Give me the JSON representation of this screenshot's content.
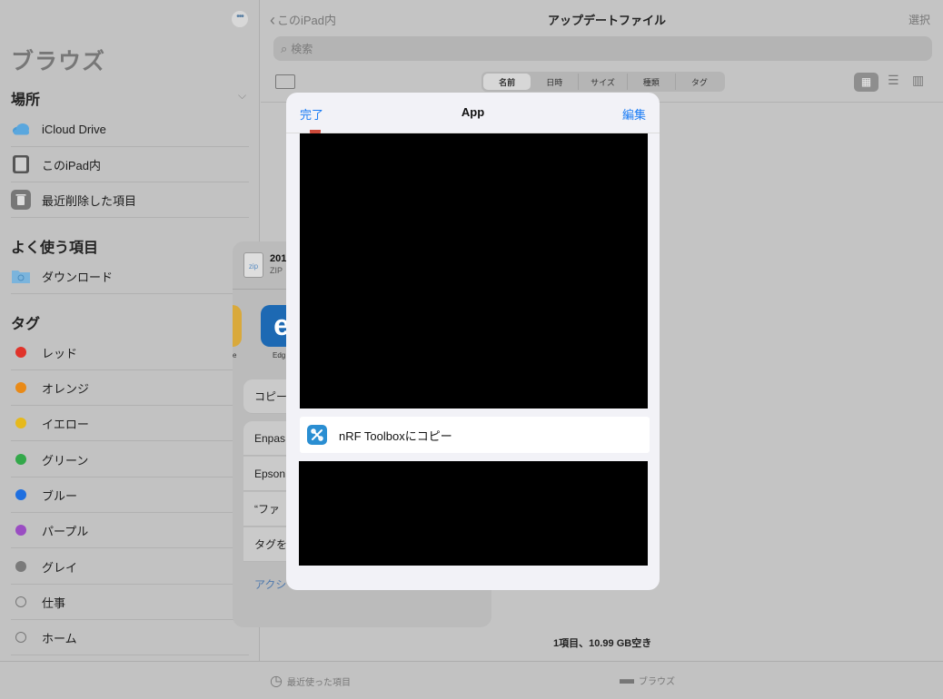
{
  "sidebar": {
    "title": "ブラウズ",
    "more_icon": "ellipsis-icon",
    "locations_header": "場所",
    "locations": [
      {
        "label": "iCloud Drive",
        "icon": "icloud-icon"
      },
      {
        "label": "このiPad内",
        "icon": "ipad-icon"
      },
      {
        "label": "最近削除した項目",
        "icon": "trash-icon"
      }
    ],
    "favorites_header": "よく使う項目",
    "favorites": [
      {
        "label": "ダウンロード",
        "icon": "folder-download-icon"
      }
    ],
    "tags_header": "タグ",
    "tags": [
      {
        "label": "レッド",
        "color": "#e0332a"
      },
      {
        "label": "オレンジ",
        "color": "#e98a17"
      },
      {
        "label": "イエロー",
        "color": "#e6b91c"
      },
      {
        "label": "グリーン",
        "color": "#33a84a"
      },
      {
        "label": "ブルー",
        "color": "#1e6fe0"
      },
      {
        "label": "パープル",
        "color": "#9a4dc2"
      },
      {
        "label": "グレイ",
        "color": "#7a7a7a"
      },
      {
        "label": "仕事",
        "color": ""
      },
      {
        "label": "ホーム",
        "color": ""
      }
    ]
  },
  "main": {
    "back_label": "このiPad内",
    "title": "アップデートファイル",
    "select_label": "選択",
    "search_placeholder": "検索",
    "sort_options": [
      "名前",
      "日時",
      "サイズ",
      "種類",
      "タグ"
    ],
    "active_sort": "名前",
    "status": "1項目、10.99 GB空き"
  },
  "tabbar": {
    "recents": "最近使った項目",
    "browse": "ブラウズ"
  },
  "share_sheet": {
    "file_name": "201",
    "file_sub": "ZIP",
    "file_icon_label": "zip",
    "apps": [
      {
        "label": "e",
        "icon": "chrome-icon"
      },
      {
        "label": "Edg",
        "icon": "edge-icon"
      }
    ],
    "actions": [
      "コピー",
      "Enpas",
      "Epson",
      "“ファ",
      "タグを"
    ],
    "footer_link": "アクシ"
  },
  "modal": {
    "done_label": "完了",
    "title": "App",
    "edit_label": "編集",
    "row_label": "nRF Toolboxにコピー",
    "row_icon": "nrf-toolbox-icon"
  }
}
